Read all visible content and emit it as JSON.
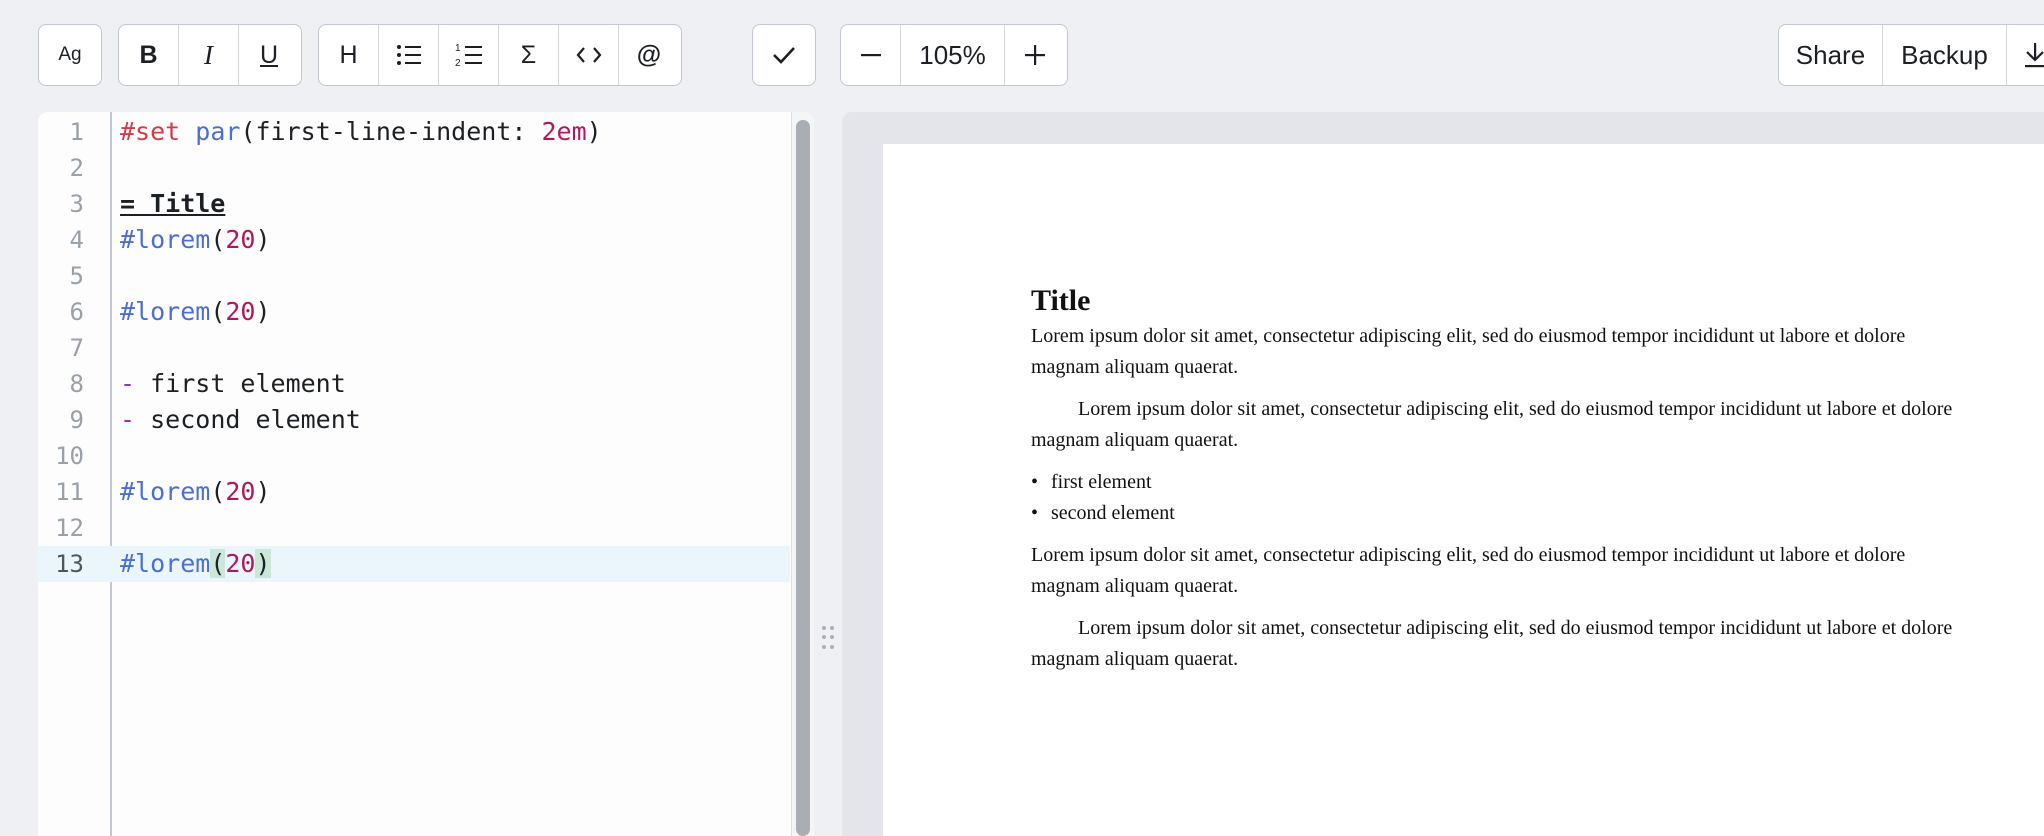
{
  "toolbar": {
    "font_button": "Ag",
    "format_group": [
      "B",
      "I",
      "U"
    ],
    "insert_group": [
      "heading-icon",
      "bullet-list-icon",
      "numbered-list-icon",
      "sigma-icon",
      "code-icon",
      "at-icon"
    ],
    "heading_label": "H",
    "sigma_label": "Σ",
    "at_label": "@",
    "zoom_level": "105%",
    "share_label": "Share",
    "backup_label": "Backup"
  },
  "editor": {
    "active_line": 13,
    "lines": [
      {
        "n": "1",
        "parts": [
          {
            "t": "#set",
            "c": "kw-red"
          },
          {
            "t": " ",
            "c": ""
          },
          {
            "t": "par",
            "c": "kw-blue"
          },
          {
            "t": "(first-line-indent: ",
            "c": ""
          },
          {
            "t": "2em",
            "c": "num"
          },
          {
            "t": ")",
            "c": ""
          }
        ]
      },
      {
        "n": "2",
        "parts": []
      },
      {
        "n": "3",
        "parts": [
          {
            "t": "= Title",
            "c": "heading"
          }
        ]
      },
      {
        "n": "4",
        "parts": [
          {
            "t": "#lorem",
            "c": "kw-blue"
          },
          {
            "t": "(",
            "c": ""
          },
          {
            "t": "20",
            "c": "num"
          },
          {
            "t": ")",
            "c": ""
          }
        ]
      },
      {
        "n": "5",
        "parts": []
      },
      {
        "n": "6",
        "parts": [
          {
            "t": "#lorem",
            "c": "kw-blue"
          },
          {
            "t": "(",
            "c": ""
          },
          {
            "t": "20",
            "c": "num"
          },
          {
            "t": ")",
            "c": ""
          }
        ]
      },
      {
        "n": "7",
        "parts": []
      },
      {
        "n": "8",
        "parts": [
          {
            "t": "-",
            "c": "bullet"
          },
          {
            "t": " first element",
            "c": ""
          }
        ]
      },
      {
        "n": "9",
        "parts": [
          {
            "t": "-",
            "c": "bullet"
          },
          {
            "t": " second element",
            "c": ""
          }
        ]
      },
      {
        "n": "10",
        "parts": []
      },
      {
        "n": "11",
        "parts": [
          {
            "t": "#lorem",
            "c": "kw-blue"
          },
          {
            "t": "(",
            "c": ""
          },
          {
            "t": "20",
            "c": "num"
          },
          {
            "t": ")",
            "c": ""
          }
        ]
      },
      {
        "n": "12",
        "parts": []
      },
      {
        "n": "13",
        "parts": [
          {
            "t": "#lorem",
            "c": "kw-blue"
          },
          {
            "t": "(",
            "c": "hl"
          },
          {
            "t": "20",
            "c": "num"
          },
          {
            "t": ")",
            "c": "hl"
          }
        ]
      }
    ]
  },
  "preview": {
    "title": "Title",
    "para1": "Lorem ipsum dolor sit amet, consectetur adipiscing elit, sed do eiusmod tempor incididunt ut labore et dolore magnam aliquam quaerat.",
    "para2": "Lorem ipsum dolor sit amet, consectetur adipiscing elit, sed do eiusmod tempor incididunt ut labore et dolore magnam aliquam quaerat.",
    "list": [
      "first element",
      "second element"
    ],
    "para3": "Lorem ipsum dolor sit amet, consectetur adipiscing elit, sed do eiusmod tempor incididunt ut labore et dolore magnam aliquam quaerat.",
    "para4": "Lorem ipsum dolor sit amet, consectetur adipiscing elit, sed do eiusmod tempor incididunt ut labore et dolore magnam aliquam quaerat."
  }
}
